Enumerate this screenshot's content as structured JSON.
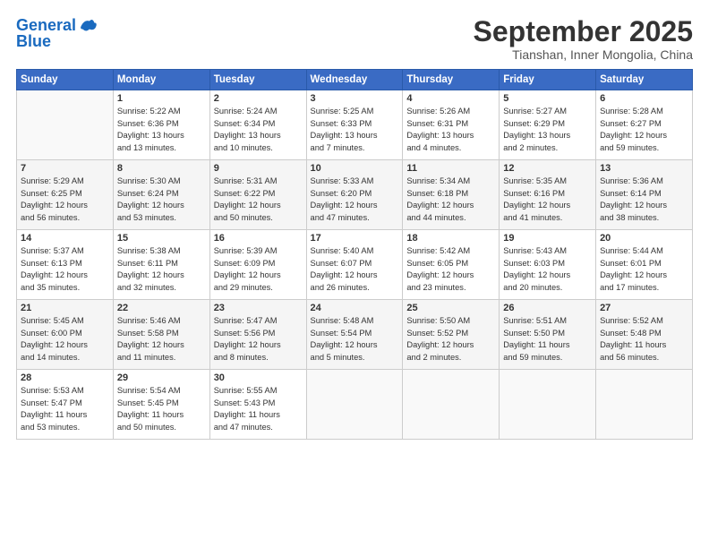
{
  "header": {
    "logo_line1": "General",
    "logo_line2": "Blue",
    "month_title": "September 2025",
    "location": "Tianshan, Inner Mongolia, China"
  },
  "days_of_week": [
    "Sunday",
    "Monday",
    "Tuesday",
    "Wednesday",
    "Thursday",
    "Friday",
    "Saturday"
  ],
  "weeks": [
    [
      {
        "day": "",
        "info": ""
      },
      {
        "day": "1",
        "info": "Sunrise: 5:22 AM\nSunset: 6:36 PM\nDaylight: 13 hours\nand 13 minutes."
      },
      {
        "day": "2",
        "info": "Sunrise: 5:24 AM\nSunset: 6:34 PM\nDaylight: 13 hours\nand 10 minutes."
      },
      {
        "day": "3",
        "info": "Sunrise: 5:25 AM\nSunset: 6:33 PM\nDaylight: 13 hours\nand 7 minutes."
      },
      {
        "day": "4",
        "info": "Sunrise: 5:26 AM\nSunset: 6:31 PM\nDaylight: 13 hours\nand 4 minutes."
      },
      {
        "day": "5",
        "info": "Sunrise: 5:27 AM\nSunset: 6:29 PM\nDaylight: 13 hours\nand 2 minutes."
      },
      {
        "day": "6",
        "info": "Sunrise: 5:28 AM\nSunset: 6:27 PM\nDaylight: 12 hours\nand 59 minutes."
      }
    ],
    [
      {
        "day": "7",
        "info": "Sunrise: 5:29 AM\nSunset: 6:25 PM\nDaylight: 12 hours\nand 56 minutes."
      },
      {
        "day": "8",
        "info": "Sunrise: 5:30 AM\nSunset: 6:24 PM\nDaylight: 12 hours\nand 53 minutes."
      },
      {
        "day": "9",
        "info": "Sunrise: 5:31 AM\nSunset: 6:22 PM\nDaylight: 12 hours\nand 50 minutes."
      },
      {
        "day": "10",
        "info": "Sunrise: 5:33 AM\nSunset: 6:20 PM\nDaylight: 12 hours\nand 47 minutes."
      },
      {
        "day": "11",
        "info": "Sunrise: 5:34 AM\nSunset: 6:18 PM\nDaylight: 12 hours\nand 44 minutes."
      },
      {
        "day": "12",
        "info": "Sunrise: 5:35 AM\nSunset: 6:16 PM\nDaylight: 12 hours\nand 41 minutes."
      },
      {
        "day": "13",
        "info": "Sunrise: 5:36 AM\nSunset: 6:14 PM\nDaylight: 12 hours\nand 38 minutes."
      }
    ],
    [
      {
        "day": "14",
        "info": "Sunrise: 5:37 AM\nSunset: 6:13 PM\nDaylight: 12 hours\nand 35 minutes."
      },
      {
        "day": "15",
        "info": "Sunrise: 5:38 AM\nSunset: 6:11 PM\nDaylight: 12 hours\nand 32 minutes."
      },
      {
        "day": "16",
        "info": "Sunrise: 5:39 AM\nSunset: 6:09 PM\nDaylight: 12 hours\nand 29 minutes."
      },
      {
        "day": "17",
        "info": "Sunrise: 5:40 AM\nSunset: 6:07 PM\nDaylight: 12 hours\nand 26 minutes."
      },
      {
        "day": "18",
        "info": "Sunrise: 5:42 AM\nSunset: 6:05 PM\nDaylight: 12 hours\nand 23 minutes."
      },
      {
        "day": "19",
        "info": "Sunrise: 5:43 AM\nSunset: 6:03 PM\nDaylight: 12 hours\nand 20 minutes."
      },
      {
        "day": "20",
        "info": "Sunrise: 5:44 AM\nSunset: 6:01 PM\nDaylight: 12 hours\nand 17 minutes."
      }
    ],
    [
      {
        "day": "21",
        "info": "Sunrise: 5:45 AM\nSunset: 6:00 PM\nDaylight: 12 hours\nand 14 minutes."
      },
      {
        "day": "22",
        "info": "Sunrise: 5:46 AM\nSunset: 5:58 PM\nDaylight: 12 hours\nand 11 minutes."
      },
      {
        "day": "23",
        "info": "Sunrise: 5:47 AM\nSunset: 5:56 PM\nDaylight: 12 hours\nand 8 minutes."
      },
      {
        "day": "24",
        "info": "Sunrise: 5:48 AM\nSunset: 5:54 PM\nDaylight: 12 hours\nand 5 minutes."
      },
      {
        "day": "25",
        "info": "Sunrise: 5:50 AM\nSunset: 5:52 PM\nDaylight: 12 hours\nand 2 minutes."
      },
      {
        "day": "26",
        "info": "Sunrise: 5:51 AM\nSunset: 5:50 PM\nDaylight: 11 hours\nand 59 minutes."
      },
      {
        "day": "27",
        "info": "Sunrise: 5:52 AM\nSunset: 5:48 PM\nDaylight: 11 hours\nand 56 minutes."
      }
    ],
    [
      {
        "day": "28",
        "info": "Sunrise: 5:53 AM\nSunset: 5:47 PM\nDaylight: 11 hours\nand 53 minutes."
      },
      {
        "day": "29",
        "info": "Sunrise: 5:54 AM\nSunset: 5:45 PM\nDaylight: 11 hours\nand 50 minutes."
      },
      {
        "day": "30",
        "info": "Sunrise: 5:55 AM\nSunset: 5:43 PM\nDaylight: 11 hours\nand 47 minutes."
      },
      {
        "day": "",
        "info": ""
      },
      {
        "day": "",
        "info": ""
      },
      {
        "day": "",
        "info": ""
      },
      {
        "day": "",
        "info": ""
      }
    ]
  ]
}
